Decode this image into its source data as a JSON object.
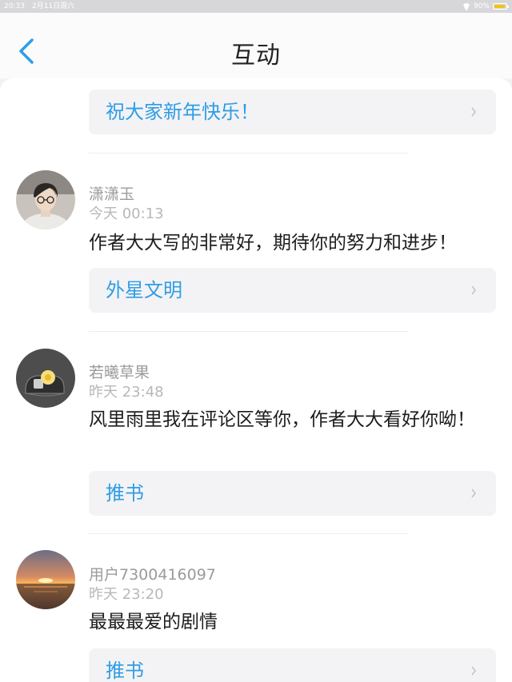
{
  "status_bar": {
    "time": "20:33",
    "date": "2月11日周六",
    "battery_text": "90%",
    "battery_level": 0.9
  },
  "nav": {
    "title": "互动"
  },
  "items": [
    {
      "card_label": "祝大家新年快乐！"
    },
    {
      "username": "潇潇玉",
      "time": "今天 00:13",
      "message": "作者大大写的非常好，期待你的努力和进步！",
      "card_label": "外星文明"
    },
    {
      "username": "若曦草果",
      "time": "昨天 23:48",
      "message": "风里雨里我在评论区等你，作者大大看好你呦！",
      "card_label": "推书"
    },
    {
      "username": "用户7300416097",
      "time": "昨天 23:20",
      "message": "最最最爱的剧情",
      "card_label": "推书"
    }
  ],
  "icons": {
    "back": "chevron-left-icon",
    "card": "chevron-right-icon",
    "wifi": "wifi-icon",
    "battery": "battery-icon"
  },
  "colors": {
    "accent": "#2f9de5",
    "battery": "#f3c40b"
  }
}
